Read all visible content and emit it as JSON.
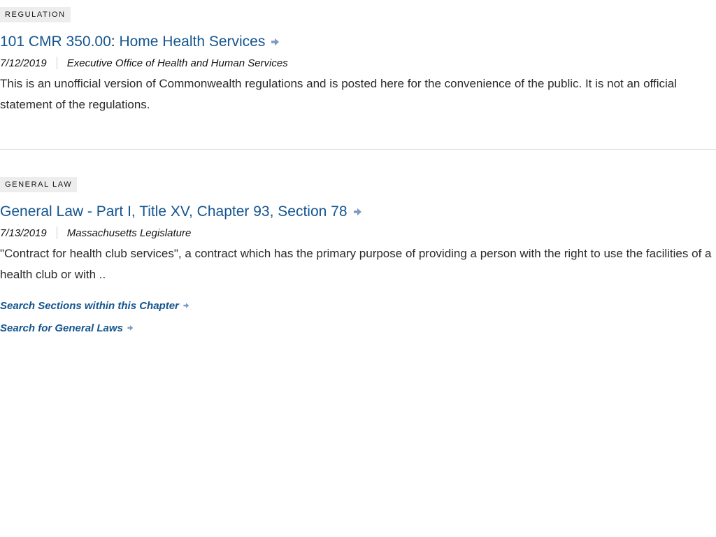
{
  "results": [
    {
      "badge": "REGULATION",
      "title_main": "101 CMR 350.00",
      "title_sep": ":",
      "title_rest": " Home Health Services",
      "date": "7/12/2019",
      "organization": "Executive Office of Health and Human Services",
      "description": "This is an unofficial version of Commonwealth regulations and is posted here for the convenience of the public. It is not an official statement of the regulations."
    },
    {
      "badge": "GENERAL LAW",
      "title": "General Law - Part I, Title XV, Chapter 93, Section 78",
      "date": "7/13/2019",
      "organization": "Massachusetts Legislature",
      "description": "\"Contract for health club services\", a contract which has the primary purpose of providing a person with the right to use the facilities of a health club or with ..",
      "links": [
        "Search Sections within this Chapter",
        "Search for General Laws"
      ]
    }
  ],
  "icons": {
    "title_arrow": "arrow-right-icon",
    "link_arrow": "arrow-right-icon"
  },
  "colors": {
    "link": "#14558f",
    "arrow": "#7a9cc0",
    "badge_bg": "#ededed",
    "divider": "#dcdcdc"
  }
}
